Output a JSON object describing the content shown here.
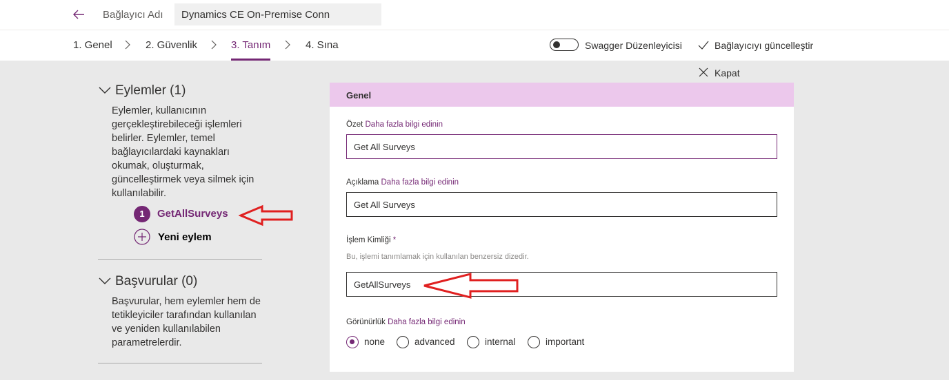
{
  "header": {
    "connector_name_label": "Bağlayıcı Adı",
    "connector_name_value": "Dynamics CE On-Premise Conn"
  },
  "steps": [
    {
      "label": "1. Genel"
    },
    {
      "label": "2. Güvenlik"
    },
    {
      "label": "3. Tanım",
      "active": true
    },
    {
      "label": "4. Sına"
    }
  ],
  "toolbar": {
    "swagger_label": "Swagger Düzenleyicisi",
    "update_label": "Bağlayıcıyı güncelleştir"
  },
  "close_label": "Kapat",
  "sidebar": {
    "actions": {
      "title": "Eylemler (1)",
      "description": "Eylemler, kullanıcının gerçekleştirebileceği işlemleri belirler. Eylemler, temel bağlayıcılardaki kaynakları okumak, oluşturmak, güncelleştirmek veya silmek için kullanılabilir.",
      "items": [
        {
          "badge": "1",
          "label": "GetAllSurveys"
        }
      ],
      "new_label": "Yeni eylem"
    },
    "references": {
      "title": "Başvurular (0)",
      "description": "Başvurular, hem eylemler hem de tetikleyiciler tarafından kullanılan ve yeniden kullanılabilen parametrelerdir."
    }
  },
  "panel": {
    "title": "Genel",
    "summary": {
      "label": "Özet",
      "link": "Daha fazla bilgi edinin",
      "value": "Get All Surveys"
    },
    "description": {
      "label": "Açıklama",
      "link": "Daha fazla bilgi edinin",
      "value": "Get All Surveys"
    },
    "operation_id": {
      "label": "İşlem Kimliği",
      "required": "*",
      "hint": "Bu, işlemi tanımlamak için kullanılan benzersiz dizedir.",
      "value": "GetAllSurveys"
    },
    "visibility": {
      "label": "Görünürlük",
      "link": "Daha fazla bilgi edinin",
      "options": [
        {
          "label": "none",
          "checked": true
        },
        {
          "label": "advanced"
        },
        {
          "label": "internal"
        },
        {
          "label": "important"
        }
      ]
    }
  },
  "colors": {
    "accent": "#742774",
    "panel_header": "#ecc8ec",
    "annotation": "#e02020"
  }
}
